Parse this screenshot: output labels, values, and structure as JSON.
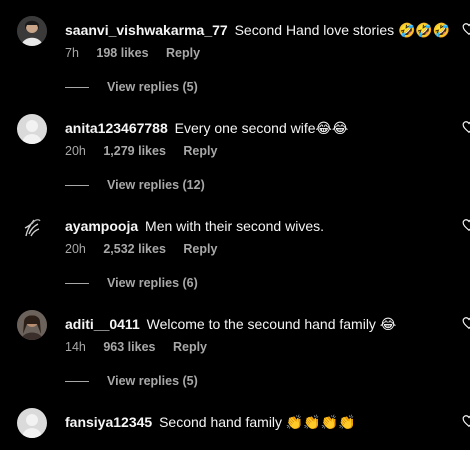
{
  "comments": [
    {
      "username": "saanvi_vishwakarma_77",
      "text": "Second Hand love stories 🤣🤣🤣",
      "time": "7h",
      "likes": "198 likes",
      "reply": "Reply",
      "view_replies": "View replies (5)"
    },
    {
      "username": "anita123467788",
      "text": "Every one second wife😂😂",
      "time": "20h",
      "likes": "1,279 likes",
      "reply": "Reply",
      "view_replies": "View replies (12)"
    },
    {
      "username": "ayampooja",
      "text": "Men with their second wives.",
      "time": "20h",
      "likes": "2,532 likes",
      "reply": "Reply",
      "view_replies": "View replies (6)"
    },
    {
      "username": "aditi__0411",
      "text": "Welcome to the secound hand family 😂",
      "time": "14h",
      "likes": "963 likes",
      "reply": "Reply",
      "view_replies": "View replies (5)"
    },
    {
      "username": "fansiya12345",
      "text": "Second hand family 👏👏👏👏",
      "time": "",
      "likes": "",
      "reply": "",
      "view_replies": ""
    }
  ],
  "colors": {
    "background": "#000000",
    "text": "#f5f5f5",
    "secondary": "#a8a8a8"
  },
  "icons": {
    "like": "heart-icon"
  }
}
